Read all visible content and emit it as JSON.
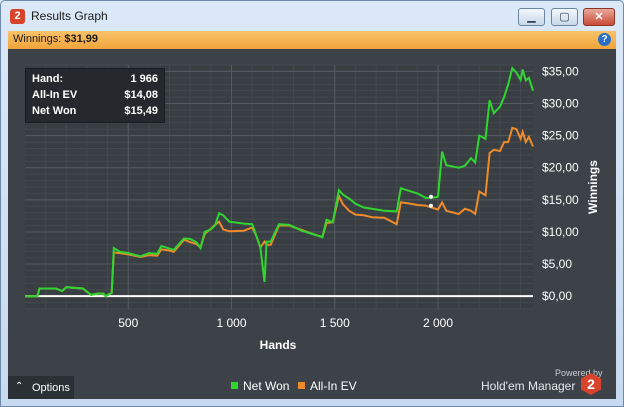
{
  "window": {
    "title": "Results Graph",
    "app_icon_text": "2",
    "buttons": {
      "minimize": "▁",
      "maximize": "▢",
      "close": "✕"
    }
  },
  "infobar": {
    "label": "Winnings:",
    "value": "$31,99",
    "help_icon": "?"
  },
  "stats": {
    "rows": [
      {
        "label": "Hand:",
        "value": "1 966"
      },
      {
        "label": "All-In EV",
        "value": "$14,08"
      },
      {
        "label": "Net Won",
        "value": "$15,49"
      }
    ]
  },
  "options": {
    "chevron": "⌃",
    "label": "Options"
  },
  "branding": {
    "powered": "Powered by",
    "name": "Hold'em Manager",
    "logo_text": "2"
  },
  "colors": {
    "net_won": "#2fd62f",
    "all_in_ev": "#ef8a2b",
    "background": "#3c4247",
    "zero_line": "#ffffff"
  },
  "chart_data": {
    "type": "line",
    "xlabel": "Hands",
    "ylabel": "Winnings",
    "xlim": [
      0,
      2460
    ],
    "ylim": [
      -2,
      36
    ],
    "x_ticks": [
      500,
      1000,
      1500,
      2000
    ],
    "x_tick_labels": [
      "500",
      "1 000",
      "1 500",
      "2 000"
    ],
    "y_ticks": [
      0,
      5,
      10,
      15,
      20,
      25,
      30,
      35
    ],
    "y_tick_labels": [
      "$0,00",
      "$5,00",
      "$10,00",
      "$15,00",
      "$20,00",
      "$25,00",
      "$30,00",
      "$35,00"
    ],
    "grid": true,
    "legend": "bottom-center",
    "series": [
      {
        "name": "Net Won",
        "color": "#2fd62f",
        "points": [
          [
            0,
            0
          ],
          [
            60,
            0
          ],
          [
            70,
            1.2
          ],
          [
            150,
            1.2
          ],
          [
            180,
            0.8
          ],
          [
            200,
            1.4
          ],
          [
            280,
            1.2
          ],
          [
            320,
            0.2
          ],
          [
            350,
            0.4
          ],
          [
            380,
            0.4
          ],
          [
            390,
            0
          ],
          [
            420,
            0.5
          ],
          [
            430,
            7.5
          ],
          [
            460,
            6.9
          ],
          [
            500,
            6.7
          ],
          [
            560,
            6.2
          ],
          [
            600,
            6.7
          ],
          [
            640,
            6.6
          ],
          [
            660,
            7.8
          ],
          [
            700,
            7.4
          ],
          [
            720,
            7.2
          ],
          [
            770,
            9
          ],
          [
            800,
            8.9
          ],
          [
            830,
            8.4
          ],
          [
            850,
            7.5
          ],
          [
            870,
            10
          ],
          [
            900,
            10.4
          ],
          [
            920,
            11
          ],
          [
            940,
            12.9
          ],
          [
            960,
            12.6
          ],
          [
            990,
            11.6
          ],
          [
            1060,
            11.3
          ],
          [
            1100,
            11.2
          ],
          [
            1120,
            9.4
          ],
          [
            1140,
            7.6
          ],
          [
            1160,
            2.2
          ],
          [
            1170,
            8.5
          ],
          [
            1190,
            8.5
          ],
          [
            1230,
            11.2
          ],
          [
            1280,
            11.1
          ],
          [
            1340,
            10.2
          ],
          [
            1400,
            9.6
          ],
          [
            1440,
            9.2
          ],
          [
            1460,
            11.9
          ],
          [
            1490,
            11.5
          ],
          [
            1520,
            16.5
          ],
          [
            1540,
            15.8
          ],
          [
            1570,
            15.2
          ],
          [
            1600,
            14.4
          ],
          [
            1640,
            13.8
          ],
          [
            1680,
            13.6
          ],
          [
            1740,
            13.3
          ],
          [
            1800,
            13.2
          ],
          [
            1820,
            16.8
          ],
          [
            1850,
            16.5
          ],
          [
            1900,
            16
          ],
          [
            1940,
            15.3
          ],
          [
            1960,
            15.3
          ],
          [
            1990,
            15.4
          ],
          [
            2000,
            15.5
          ],
          [
            2020,
            22.5
          ],
          [
            2040,
            20.4
          ],
          [
            2100,
            20
          ],
          [
            2130,
            20.3
          ],
          [
            2160,
            21.5
          ],
          [
            2180,
            20.8
          ],
          [
            2200,
            25
          ],
          [
            2230,
            24.5
          ],
          [
            2250,
            30.5
          ],
          [
            2270,
            28.5
          ],
          [
            2300,
            29.5
          ],
          [
            2320,
            31
          ],
          [
            2340,
            33
          ],
          [
            2360,
            35.5
          ],
          [
            2380,
            34.8
          ],
          [
            2400,
            33.7
          ],
          [
            2410,
            35.3
          ],
          [
            2425,
            33.6
          ],
          [
            2440,
            34
          ],
          [
            2460,
            32
          ]
        ]
      },
      {
        "name": "All-In EV",
        "color": "#ef8a2b",
        "points": [
          [
            0,
            0
          ],
          [
            60,
            0
          ],
          [
            70,
            1.2
          ],
          [
            150,
            1.2
          ],
          [
            180,
            0.8
          ],
          [
            200,
            1.4
          ],
          [
            280,
            1.2
          ],
          [
            320,
            0.2
          ],
          [
            350,
            0.4
          ],
          [
            380,
            0.4
          ],
          [
            390,
            0
          ],
          [
            420,
            0.5
          ],
          [
            430,
            6.8
          ],
          [
            460,
            6.7
          ],
          [
            500,
            6.5
          ],
          [
            560,
            6.1
          ],
          [
            600,
            6.4
          ],
          [
            640,
            6.3
          ],
          [
            660,
            7.3
          ],
          [
            700,
            7.1
          ],
          [
            720,
            6.9
          ],
          [
            770,
            8.8
          ],
          [
            800,
            8.4
          ],
          [
            830,
            8.1
          ],
          [
            850,
            7.6
          ],
          [
            870,
            9.7
          ],
          [
            900,
            10.5
          ],
          [
            920,
            11.1
          ],
          [
            940,
            11.6
          ],
          [
            960,
            10.4
          ],
          [
            990,
            10.1
          ],
          [
            1060,
            10.2
          ],
          [
            1100,
            10.7
          ],
          [
            1120,
            9.4
          ],
          [
            1140,
            7.6
          ],
          [
            1160,
            8.5
          ],
          [
            1170,
            8
          ],
          [
            1190,
            8
          ],
          [
            1230,
            11
          ],
          [
            1280,
            11
          ],
          [
            1340,
            10.3
          ],
          [
            1400,
            9.6
          ],
          [
            1440,
            9.2
          ],
          [
            1460,
            11.4
          ],
          [
            1490,
            11.5
          ],
          [
            1520,
            15.6
          ],
          [
            1540,
            14.3
          ],
          [
            1570,
            13.3
          ],
          [
            1600,
            12.7
          ],
          [
            1640,
            12.6
          ],
          [
            1680,
            12.3
          ],
          [
            1740,
            12.2
          ],
          [
            1800,
            11.2
          ],
          [
            1820,
            14.6
          ],
          [
            1850,
            14.5
          ],
          [
            1900,
            14.2
          ],
          [
            1940,
            14.1
          ],
          [
            1960,
            13.9
          ],
          [
            2000,
            13.5
          ],
          [
            2020,
            14.6
          ],
          [
            2040,
            13.3
          ],
          [
            2100,
            12.8
          ],
          [
            2130,
            13.6
          ],
          [
            2160,
            13.3
          ],
          [
            2180,
            12.8
          ],
          [
            2200,
            16.3
          ],
          [
            2230,
            15.7
          ],
          [
            2250,
            22.3
          ],
          [
            2270,
            22.8
          ],
          [
            2300,
            22.6
          ],
          [
            2320,
            24
          ],
          [
            2340,
            24
          ],
          [
            2360,
            26.2
          ],
          [
            2380,
            26
          ],
          [
            2400,
            24.5
          ],
          [
            2410,
            25.6
          ],
          [
            2425,
            24
          ],
          [
            2440,
            24.8
          ],
          [
            2460,
            23.3
          ]
        ]
      }
    ],
    "hover": {
      "x": 1966,
      "net_won": 15.49,
      "all_in_ev": 14.08
    }
  }
}
